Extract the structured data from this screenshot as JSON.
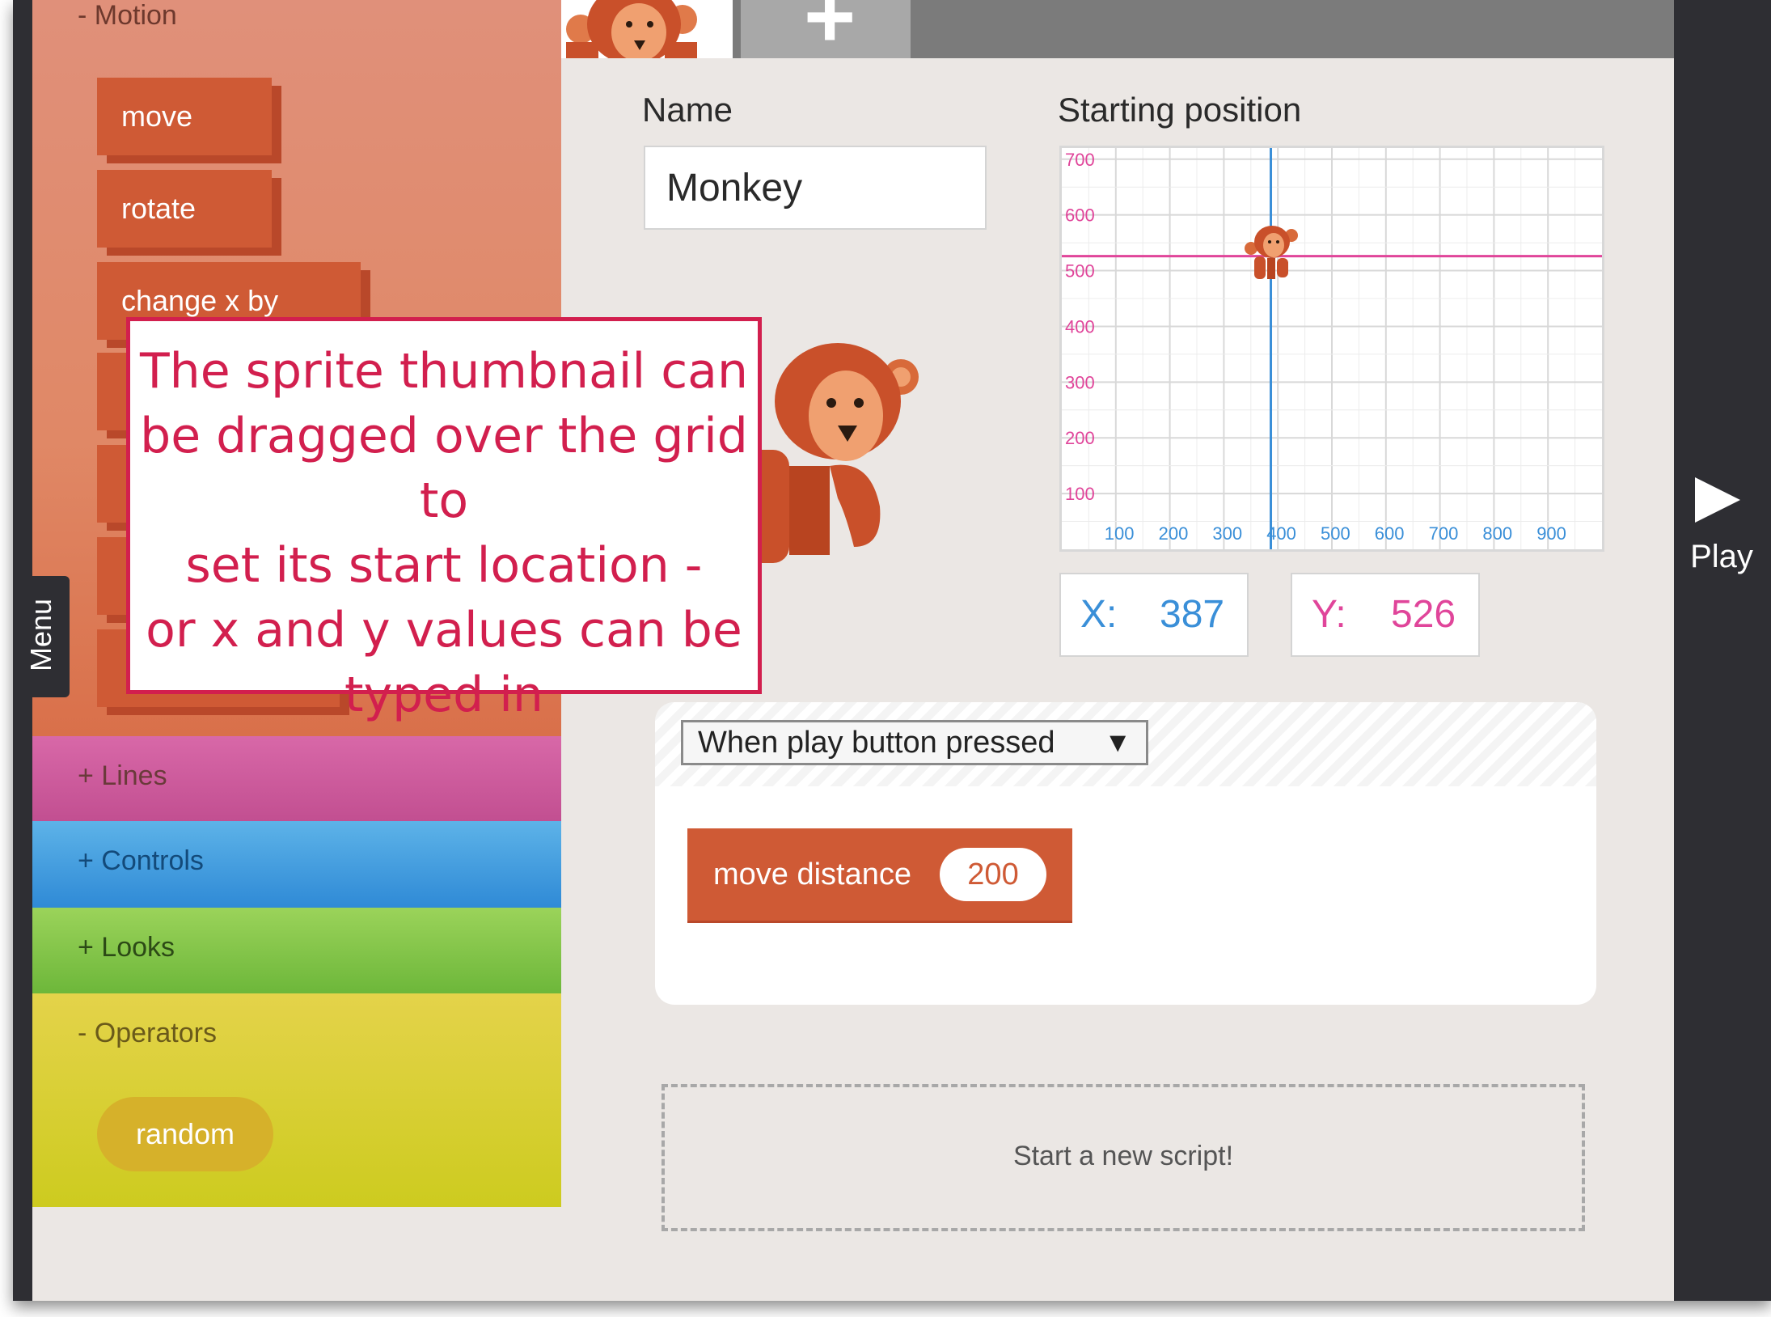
{
  "sidebar": {
    "motion": {
      "title": "- Motion",
      "blocks": [
        "move",
        "rotate",
        "change x by"
      ]
    },
    "categories": {
      "lines": "+ Lines",
      "controls": "+ Controls",
      "looks": "+ Looks",
      "operators": "- Operators"
    },
    "operators_blocks": [
      "random"
    ],
    "menu_label": "Menu"
  },
  "tabs": {
    "add_label": "+"
  },
  "sprite": {
    "name_label": "Name",
    "name_value": "Monkey",
    "position_label": "Starting position",
    "x_label": "X:",
    "x_value": "387",
    "y_label": "Y:",
    "y_value": "526"
  },
  "chart_data": {
    "type": "scatter",
    "title": "Starting position",
    "x_ticks": [
      "100",
      "200",
      "300",
      "400",
      "500",
      "600",
      "700",
      "800",
      "900"
    ],
    "y_ticks": [
      "100",
      "200",
      "300",
      "400",
      "500",
      "600",
      "700"
    ],
    "xlim": [
      0,
      1000
    ],
    "ylim": [
      0,
      720
    ],
    "points": [
      {
        "x": 387,
        "y": 526
      }
    ],
    "grid": true,
    "colors": {
      "x_axis": "#3a8fd8",
      "y_axis": "#e0459a",
      "grid": "#d8d8d8"
    }
  },
  "script": {
    "trigger": "When play button pressed",
    "trigger_arrow": "▼",
    "block_label": "move distance",
    "block_value": "200",
    "new_script": "Start a new script!"
  },
  "play": {
    "label": "Play"
  },
  "callout": {
    "text": "The sprite thumbnail can\nbe dragged over the grid to\nset its start location -\nor x and y values can be\ntyped in",
    "color": "#d21f4e"
  },
  "colors": {
    "motion": "#cf5a35",
    "lines": "#c24f91",
    "controls": "#2f8ad6",
    "looks": "#6db73a",
    "operators": "#cdcb1f"
  }
}
